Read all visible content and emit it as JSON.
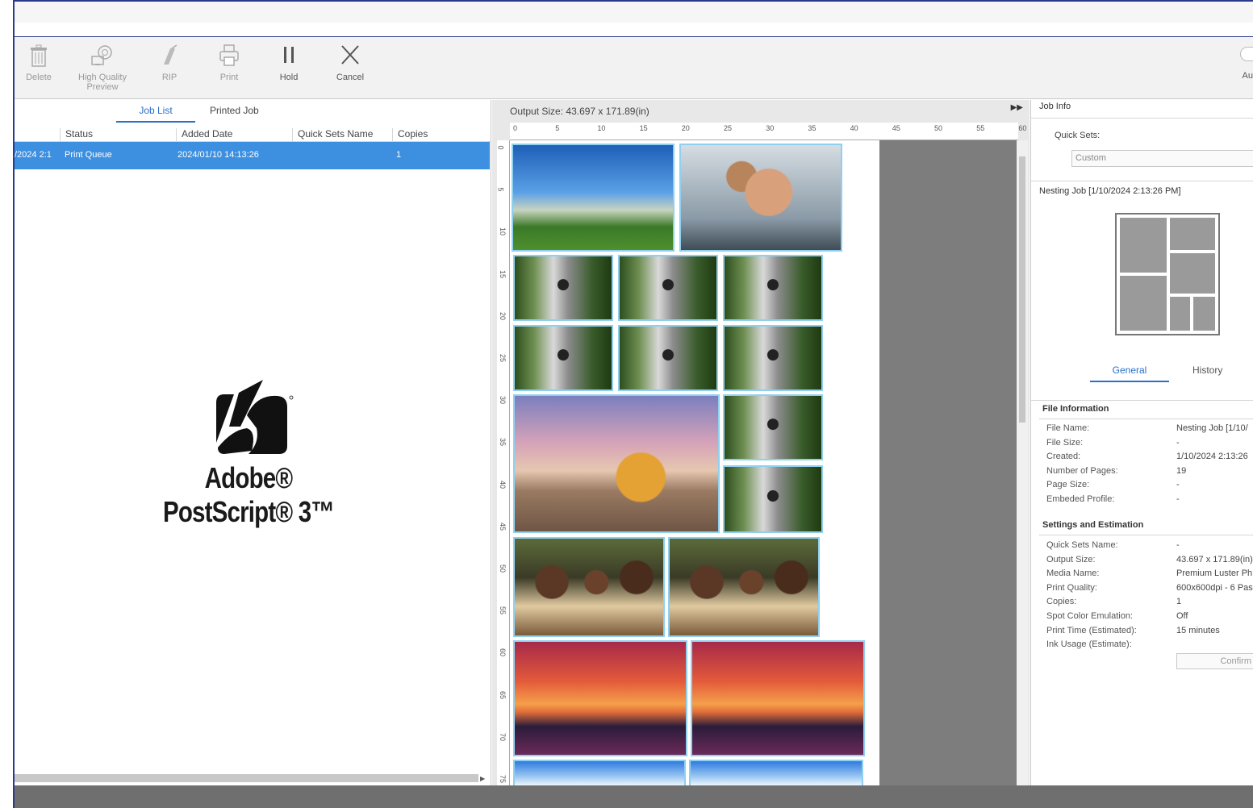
{
  "toolbar": {
    "delete": "Delete",
    "hq_preview": "High Quality Preview",
    "rip": "RIP",
    "print": "Print",
    "hold": "Hold",
    "cancel": "Cancel",
    "auto": "Au"
  },
  "job_panel": {
    "tabs": [
      "Job List",
      "Printed Job"
    ],
    "active_tab": "Job List",
    "columns": [
      "Status",
      "Added Date",
      "Quick Sets Name",
      "Copies"
    ],
    "rows": [
      {
        "date_trunc": "/2024 2:1",
        "status": "Print Queue",
        "added": "2024/01/10 14:13:26",
        "quick_sets": "",
        "copies": "1"
      }
    ],
    "logo_text": "Adobe® PostScript® 3™"
  },
  "preview": {
    "output_size_label": "Output Size:",
    "output_size_value": "43.697 x 171.89(in)",
    "ruler_top": [
      "0",
      "5",
      "10",
      "15",
      "20",
      "25",
      "30",
      "35",
      "40",
      "45",
      "50",
      "55",
      "60"
    ],
    "ruler_left": [
      "0",
      "5",
      "10",
      "15",
      "20",
      "25",
      "30",
      "35",
      "40",
      "45",
      "50",
      "55",
      "60",
      "65",
      "70",
      "75"
    ]
  },
  "job_info": {
    "title": "Job Info",
    "quick_sets_label": "Quick Sets:",
    "quick_sets_value": "Custom",
    "nesting_job": "Nesting Job [1/10/2024 2:13:26 PM]",
    "sub_tabs": [
      "General",
      "History"
    ],
    "active_sub_tab": "General",
    "file_info_title": "File Information",
    "file_info": [
      {
        "k": "File Name:",
        "v": "Nesting Job [1/10/"
      },
      {
        "k": "File Size:",
        "v": "-"
      },
      {
        "k": "Created:",
        "v": "1/10/2024 2:13:26"
      },
      {
        "k": "Number of Pages:",
        "v": "19"
      },
      {
        "k": "Page Size:",
        "v": "-"
      },
      {
        "k": "Embeded Profile:",
        "v": "-"
      }
    ],
    "settings_title": "Settings and Estimation",
    "settings": [
      {
        "k": "Quick Sets Name:",
        "v": "-"
      },
      {
        "k": "Output Size:",
        "v": "43.697 x 171.89(in)"
      },
      {
        "k": "Media Name:",
        "v": "Premium Luster Ph"
      },
      {
        "k": "Print Quality:",
        "v": "600x600dpi - 6 Pas"
      },
      {
        "k": "Copies:",
        "v": "1"
      },
      {
        "k": "Spot Color Emulation:",
        "v": "Off"
      },
      {
        "k": "Print Time (Estimated):",
        "v": "15 minutes"
      },
      {
        "k": "Ink Usage (Estimate):",
        "v": ""
      }
    ],
    "confirm": "Confirm"
  }
}
